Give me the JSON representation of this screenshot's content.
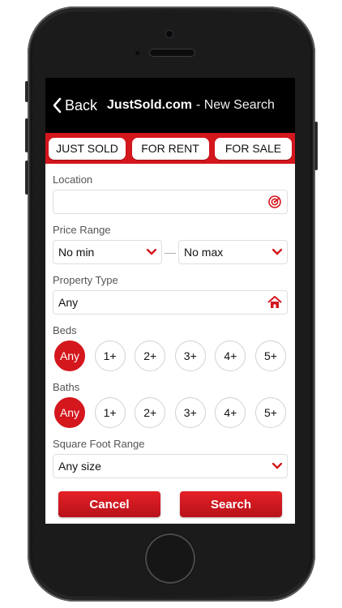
{
  "nav": {
    "back_label": "Back",
    "site_name": "JustSold.com",
    "subtitle": "- New Search"
  },
  "tabs": [
    "JUST SOLD",
    "FOR RENT",
    "FOR SALE"
  ],
  "location": {
    "label": "Location",
    "value": "",
    "icon": "location-target-icon"
  },
  "price_range": {
    "label": "Price Range",
    "min": "No min",
    "separator": "—",
    "max": "No max"
  },
  "property_type": {
    "label": "Property Type",
    "value": "Any",
    "icon": "home-icon"
  },
  "beds": {
    "label": "Beds",
    "options": [
      "Any",
      "1+",
      "2+",
      "3+",
      "4+",
      "5+"
    ],
    "selected": "Any"
  },
  "baths": {
    "label": "Baths",
    "options": [
      "Any",
      "1+",
      "2+",
      "3+",
      "4+",
      "5+"
    ],
    "selected": "Any"
  },
  "square_foot": {
    "label": "Square Foot Range",
    "value": "Any size"
  },
  "buttons": {
    "cancel": "Cancel",
    "search": "Search"
  },
  "colors": {
    "accent": "#d4161d",
    "nav_bg": "#000000"
  }
}
